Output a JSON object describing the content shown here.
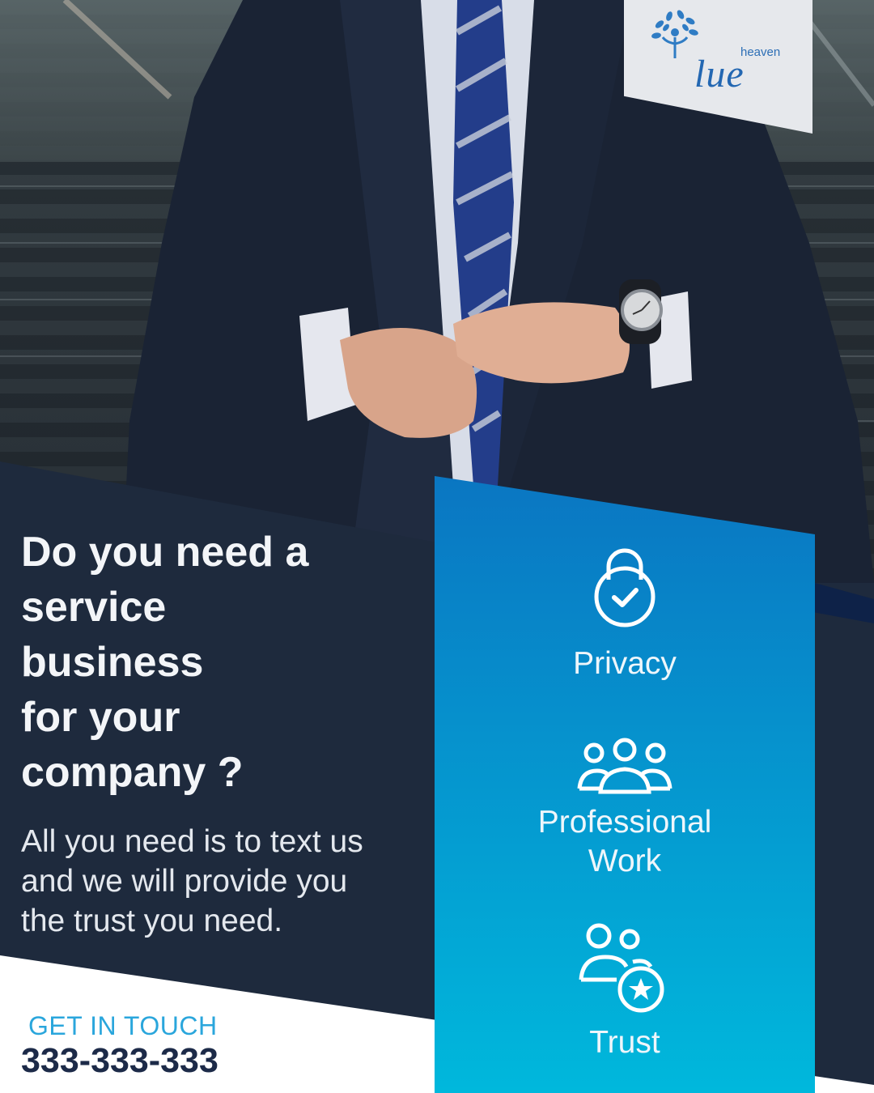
{
  "brand": {
    "logo_small": "heaven",
    "logo_main": "lue",
    "logo_icon": "tree-icon"
  },
  "headline": "Do you need a\nservice\nbusiness\nfor your\ncompany ?",
  "body": "All you need is to text us\nand we will provide you\nthe trust you need.",
  "contact": {
    "label": "GET IN TOUCH",
    "phone": "333-333-333"
  },
  "features": [
    {
      "label": "Privacy",
      "icon": "padlock-check-icon"
    },
    {
      "label": "Professional\nWork",
      "icon": "team-icon"
    },
    {
      "label": "Trust",
      "icon": "user-star-icon"
    }
  ],
  "colors": {
    "navy_panel": "#1e2a3d",
    "blue_panel_top": "#0a76c2",
    "blue_panel_bottom": "#00b8dc",
    "accent_text": "#2aa6dc",
    "phone_text": "#1c2a48",
    "deep_navy": "#0e2248"
  }
}
